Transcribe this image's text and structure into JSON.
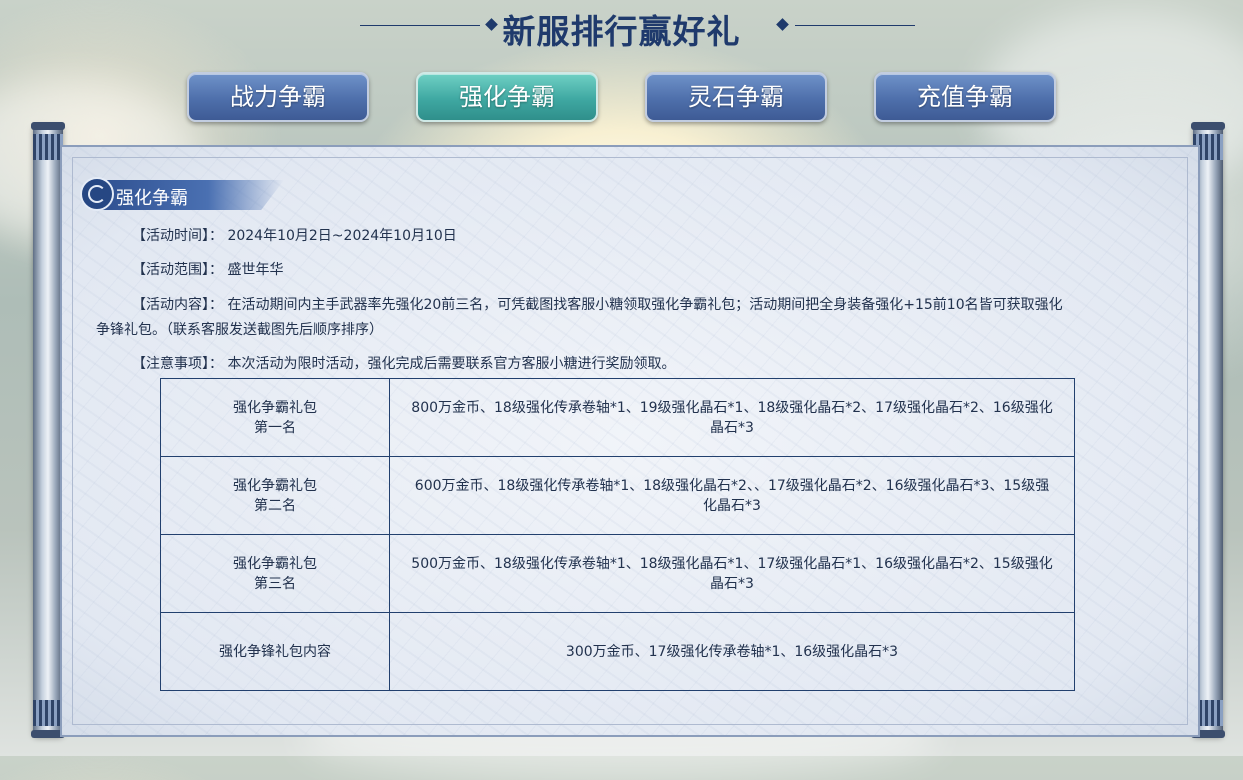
{
  "header": {
    "title": "新服排行赢好礼"
  },
  "tabs": [
    {
      "label": "战力争霸",
      "active": false
    },
    {
      "label": "强化争霸",
      "active": true
    },
    {
      "label": "灵石争霸",
      "active": false
    },
    {
      "label": "充值争霸",
      "active": false
    }
  ],
  "section": {
    "title": "强化争霸",
    "time_label": "【活动时间】：",
    "time_value": "2024年10月2日~2024年10月10日",
    "scope_label": "【活动范围】：",
    "scope_value": "盛世年华",
    "content_label": "【活动内容】：",
    "content_line1": "在活动期间内主手武器率先强化20前三名，可凭截图找客服小糖领取强化争霸礼包；活动期间把全身装备强化+15前10名皆可获取强化",
    "content_line2": "争锋礼包。（联系客服发送截图先后顺序排序）",
    "note_label": "【注意事项】：",
    "note_value": "本次活动为限时活动，强化完成后需要联系官方客服小糖进行奖励领取。"
  },
  "rewards": [
    {
      "name_line1": "强化争霸礼包",
      "name_line2": "第一名",
      "items_line1": "800万金币、18级强化传承卷轴*1、19级强化晶石*1、18级强化晶石*2、17级强化晶石*2、16级强化",
      "items_line2": "晶石*3"
    },
    {
      "name_line1": "强化争霸礼包",
      "name_line2": "第二名",
      "items_line1": "600万金币、18级强化传承卷轴*1、18级强化晶石*2、、17级强化晶石*2、16级强化晶石*3、15级强",
      "items_line2": "化晶石*3"
    },
    {
      "name_line1": "强化争霸礼包",
      "name_line2": "第三名",
      "items_line1": "500万金币、18级强化传承卷轴*1、18级强化晶石*1、17级强化晶石*1、16级强化晶石*2、15级强化",
      "items_line2": "晶石*3"
    },
    {
      "name_line1": "强化争锋礼包内容",
      "name_line2": "",
      "items_line1": "300万金币、17级强化传承卷轴*1、16级强化晶石*3",
      "items_line2": ""
    }
  ],
  "colors": {
    "title": "#1f3a6c",
    "tab": "#4e6fab",
    "tab_active": "#3fa8a2",
    "border": "#22406e"
  }
}
